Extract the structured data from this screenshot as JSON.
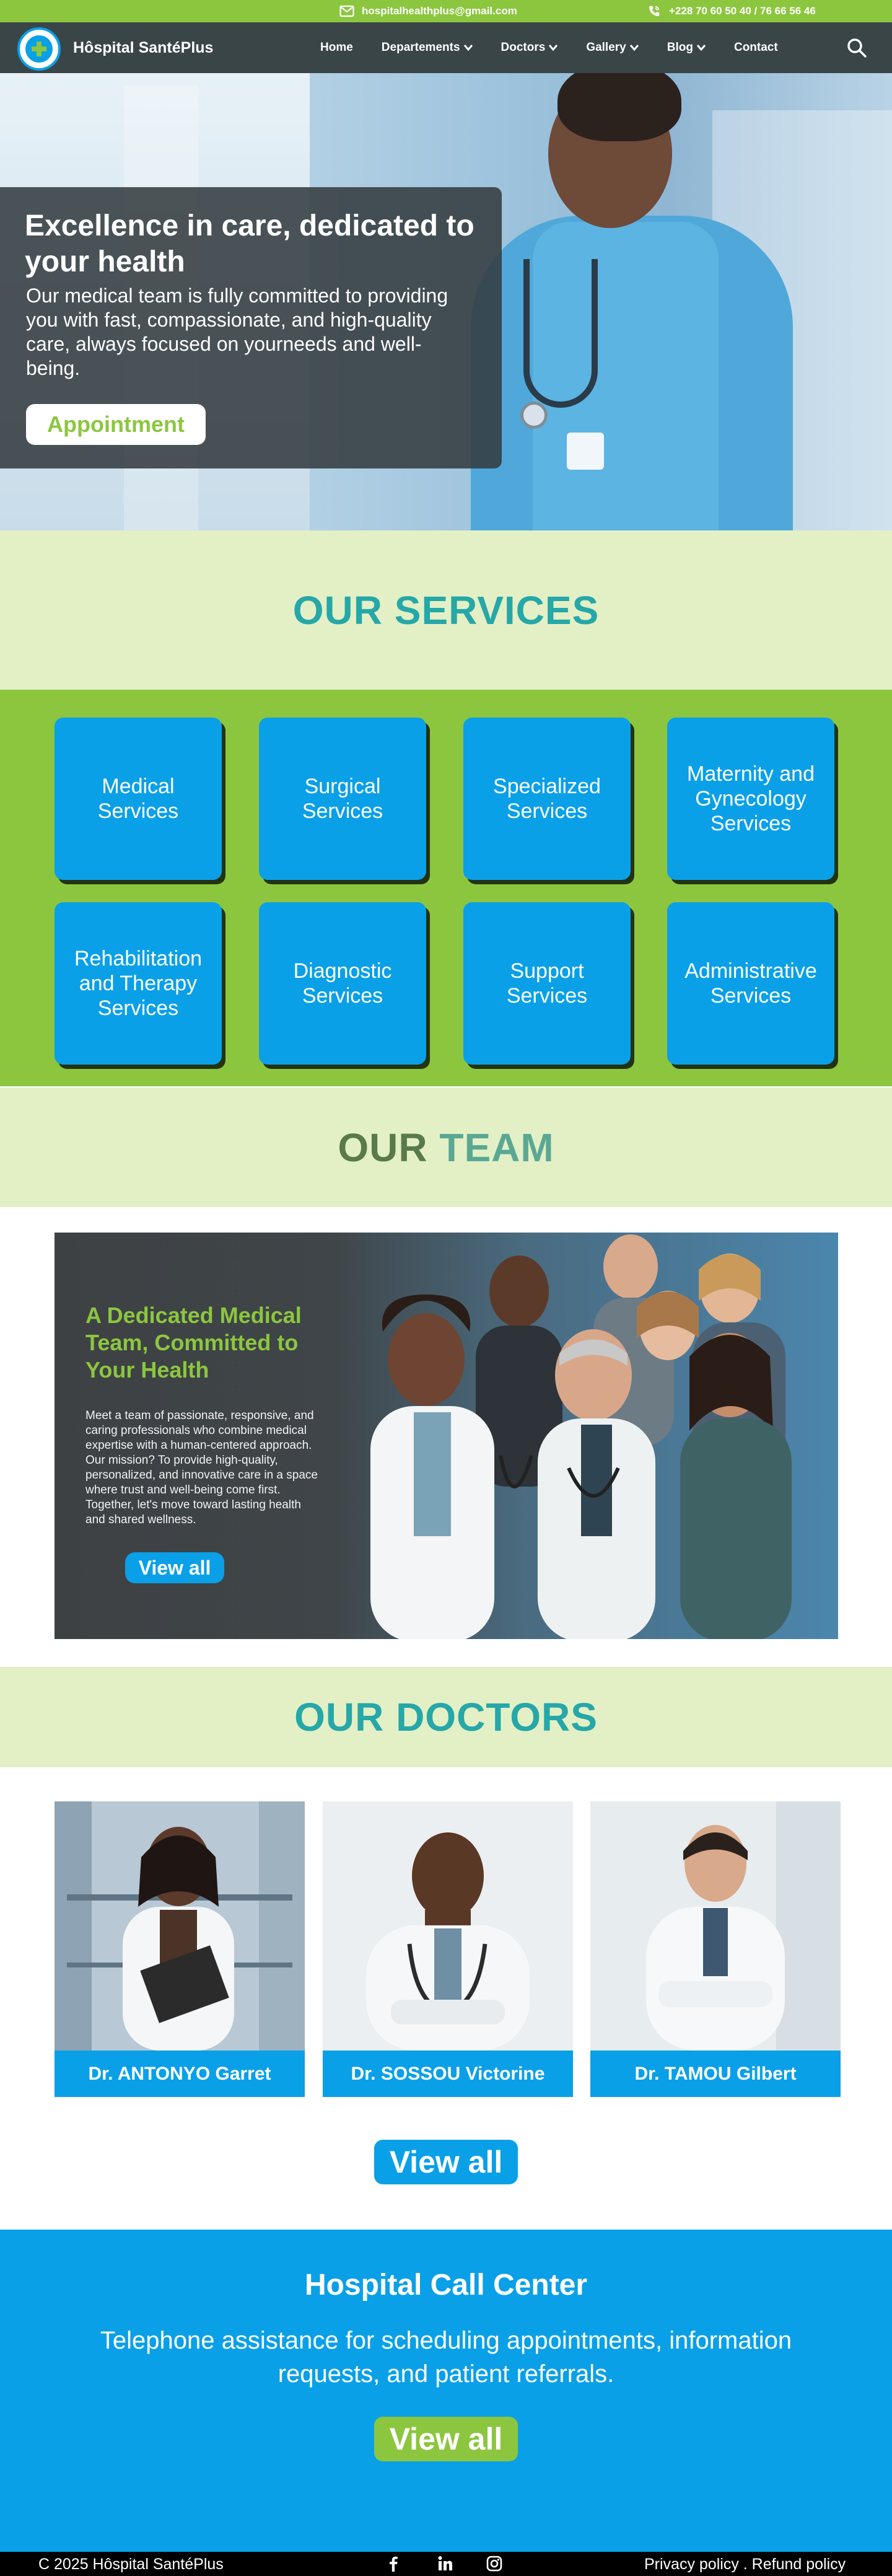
{
  "topbar": {
    "email": "hospitalhealthplus@gmail.com",
    "phone": "+228 70 60 50 40 / 76 66 56 46"
  },
  "nav": {
    "brand": "Hôspital SantéPlus",
    "items": [
      {
        "label": "Home"
      },
      {
        "label": "Departements"
      },
      {
        "label": "Doctors"
      },
      {
        "label": "Gallery"
      },
      {
        "label": "Blog"
      },
      {
        "label": "Contact"
      }
    ]
  },
  "hero": {
    "title": "Excellence  in care, dedicated to your health",
    "text": "Our medical team is fully committed to providing you  with fast, compassionate, and high-quality care, always focused on yourneeds and well-being.",
    "button": "Appointment"
  },
  "services": {
    "title": "OUR SERVICES",
    "items": [
      "Medical Services",
      "Surgical Services",
      "Specialized Services",
      "Maternity and Gynecology Services",
      "Rehabilitation and Therapy Services",
      "Diagnostic Services",
      "Support Services",
      "Administrative Services"
    ]
  },
  "team": {
    "title_part1": "OUR",
    "title_part2": "TEAM",
    "heading": "A Dedicated Medical Team, Committed to Your Health",
    "text": "Meet a team of passionate, responsive, and caring professionals who combine medical expertise with a human-centered approach. Our mission? To provide high-quality, personalized, and innovative care in a space where trust and well-being come first. Together, let's move toward lasting health and shared wellness.",
    "button": "View all"
  },
  "doctors": {
    "title": "OUR DOCTORS",
    "items": [
      {
        "name": "Dr. ANTONYO Garret"
      },
      {
        "name": "Dr. SOSSOU Victorine"
      },
      {
        "name": "Dr. TAMOU Gilbert"
      }
    ],
    "button": "View all"
  },
  "call_center": {
    "title": "Hospital Call Center",
    "text": "Telephone assistance for scheduling appointments, information requests, and patient referrals.",
    "button": "View all"
  },
  "footer": {
    "copyright": "C 2025 Hôspital SantéPlus",
    "privacy": "Privacy policy",
    "separator": " . ",
    "refund": "Refund policy"
  },
  "icons": {
    "email": "mail-icon",
    "phone": "phone-icon",
    "search": "search-icon",
    "social": [
      "facebook-icon",
      "linkedin-icon",
      "instagram-icon"
    ]
  },
  "colors": {
    "accent_green": "#8cc63f",
    "accent_blue": "#0aa0e8",
    "teal_title": "#26a7a8",
    "band_bg": "#e3f0c6",
    "nav_bg": "#3a4548"
  }
}
